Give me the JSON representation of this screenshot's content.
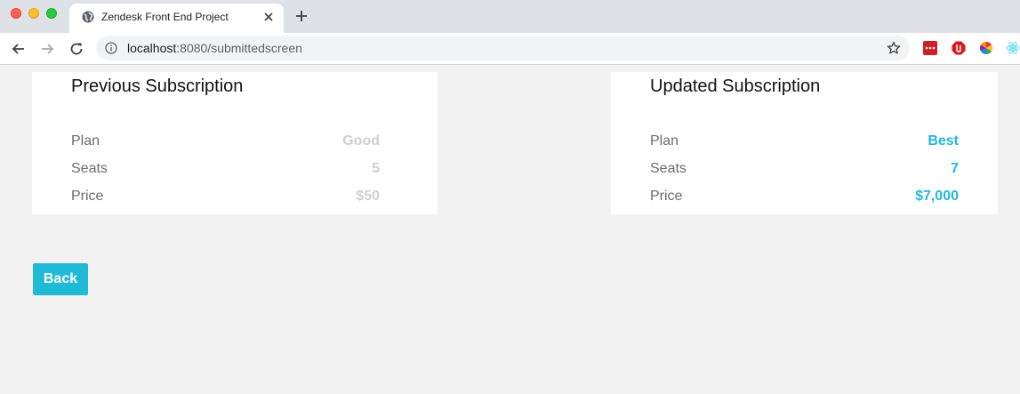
{
  "browser": {
    "tab_title": "Zendesk Front End Project",
    "url_host": "localhost",
    "url_rest": ":8080/submittedscreen"
  },
  "previous": {
    "heading": "Previous Subscription",
    "rows": [
      {
        "label": "Plan",
        "value": "Good"
      },
      {
        "label": "Seats",
        "value": "5"
      },
      {
        "label": "Price",
        "value": "$50"
      }
    ]
  },
  "updated": {
    "heading": "Updated Subscription",
    "rows": [
      {
        "label": "Plan",
        "value": "Best"
      },
      {
        "label": "Seats",
        "value": "7"
      },
      {
        "label": "Price",
        "value": "$7,000"
      }
    ]
  },
  "actions": {
    "back_label": "Back"
  },
  "colors": {
    "accent": "#1fbad6",
    "previous_value": "#cfcfcf",
    "page_background": "#f2f2f2"
  }
}
